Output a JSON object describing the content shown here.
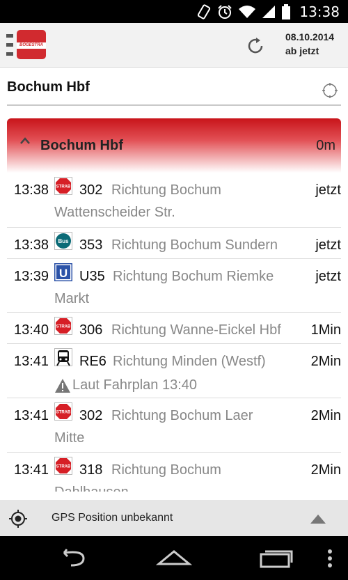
{
  "status_bar": {
    "time": "13:38",
    "icons": [
      "screen-rotation-icon",
      "alarm-icon",
      "wifi-icon",
      "signal-icon",
      "battery-icon"
    ]
  },
  "app_bar": {
    "logo_text": "BOGESTRA",
    "date": "08.10.2014",
    "time_mode": "ab jetzt",
    "brand_color": "#d12a2f"
  },
  "search": {
    "value": "Bochum Hbf"
  },
  "station": {
    "name": "Bochum Hbf",
    "distance": "0m",
    "accent_gradient": [
      "#c8141a",
      "#ffffff"
    ]
  },
  "departures": [
    {
      "time": "13:38",
      "type": "strab",
      "type_label": "STRAB",
      "line": "302",
      "direction": "Richtung Bochum",
      "direction_cont": "Wattenscheider Str.",
      "when": "jetzt"
    },
    {
      "time": "13:38",
      "type": "bus",
      "type_label": "Bus",
      "line": "353",
      "direction": "Richtung Bochum Sundern",
      "when": "jetzt"
    },
    {
      "time": "13:39",
      "type": "ubahn",
      "type_label": "U",
      "line": "U35",
      "direction": "Richtung Bochum Riemke",
      "direction_cont": "Markt",
      "when": "jetzt"
    },
    {
      "time": "13:40",
      "type": "strab",
      "type_label": "STRAB",
      "line": "306",
      "direction": "Richtung Wanne-Eickel Hbf",
      "when": "1Min"
    },
    {
      "time": "13:41",
      "type": "train",
      "line": "RE6",
      "direction": "Richtung Minden (Westf)",
      "when": "2Min",
      "warning": "Laut Fahrplan 13:40"
    },
    {
      "time": "13:41",
      "type": "strab",
      "type_label": "STRAB",
      "line": "302",
      "direction": "Richtung Bochum Laer",
      "direction_cont": "Mitte",
      "when": "2Min"
    },
    {
      "time": "13:41",
      "type": "strab",
      "type_label": "STRAB",
      "line": "318",
      "direction": "Richtung Bochum",
      "direction_cont": "Dahlhausen",
      "when": "2Min"
    }
  ],
  "gps": {
    "status": "GPS Position unbekannt"
  },
  "nav_bar": {
    "icons": [
      "back-icon",
      "home-icon",
      "recents-icon",
      "overflow-menu-icon"
    ]
  }
}
